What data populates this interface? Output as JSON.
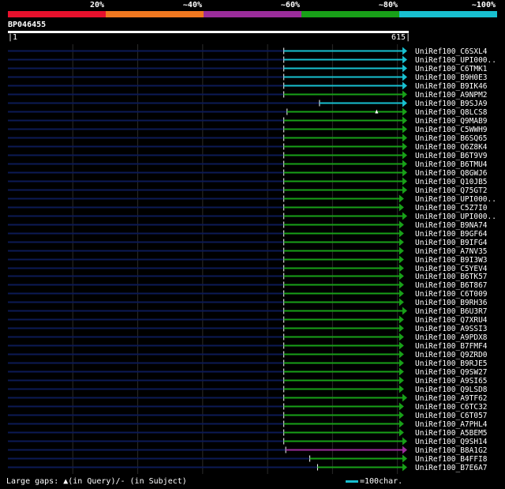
{
  "query": {
    "id": "BP046455",
    "start": "1",
    "end": "615",
    "length": 615
  },
  "legend": [
    {
      "label": "20%",
      "color": "#e8112d"
    },
    {
      "label": "~40%",
      "color": "#f07820"
    },
    {
      "label": "~60%",
      "color": "#9b2d9b"
    },
    {
      "label": "~80%",
      "color": "#18a018"
    },
    {
      "label": "~100%",
      "color": "#18c0d0"
    }
  ],
  "footer": {
    "gaps_text": "Large gaps: ▲(in Query)/- (in Subject)",
    "scale_text": "=100char."
  },
  "chart_data": {
    "type": "alignment",
    "query_length": 615,
    "hits": [
      {
        "name": "UniRef100_C6SXL4",
        "start": 425,
        "end": 615,
        "identity_band": "~100%"
      },
      {
        "name": "UniRef100_UPI000..",
        "start": 425,
        "end": 615,
        "identity_band": "~100%"
      },
      {
        "name": "UniRef100_C6TMK1",
        "start": 425,
        "end": 615,
        "identity_band": "~100%"
      },
      {
        "name": "UniRef100_B9H0E3",
        "start": 425,
        "end": 615,
        "identity_band": "~100%"
      },
      {
        "name": "UniRef100_B9IK46",
        "start": 425,
        "end": 615,
        "identity_band": "~100%"
      },
      {
        "name": "UniRef100_A9NPM2",
        "start": 425,
        "end": 615,
        "identity_band": "~80%"
      },
      {
        "name": "UniRef100_B9SJA9",
        "start": 480,
        "end": 615,
        "identity_band": "~100%"
      },
      {
        "name": "UniRef100_Q8LCS8",
        "start": 430,
        "end": 615,
        "identity_band": "~80%",
        "query_gap_at": 568
      },
      {
        "name": "UniRef100_Q9MAB9",
        "start": 425,
        "end": 615,
        "identity_band": "~80%"
      },
      {
        "name": "UniRef100_C5WWH9",
        "start": 425,
        "end": 615,
        "identity_band": "~80%"
      },
      {
        "name": "UniRef100_B6SQ65",
        "start": 425,
        "end": 615,
        "identity_band": "~80%"
      },
      {
        "name": "UniRef100_Q6Z8K4",
        "start": 425,
        "end": 615,
        "identity_band": "~80%"
      },
      {
        "name": "UniRef100_B6T9V9",
        "start": 425,
        "end": 615,
        "identity_band": "~80%"
      },
      {
        "name": "UniRef100_B6TMU4",
        "start": 425,
        "end": 615,
        "identity_band": "~80%"
      },
      {
        "name": "UniRef100_Q8GWJ6",
        "start": 425,
        "end": 615,
        "identity_band": "~80%"
      },
      {
        "name": "UniRef100_Q10JB5",
        "start": 425,
        "end": 615,
        "identity_band": "~80%"
      },
      {
        "name": "UniRef100_Q75GT2",
        "start": 425,
        "end": 615,
        "identity_band": "~80%"
      },
      {
        "name": "UniRef100_UPI000..",
        "start": 425,
        "end": 610,
        "identity_band": "~80%"
      },
      {
        "name": "UniRef100_C5Z7I0",
        "start": 425,
        "end": 610,
        "identity_band": "~80%"
      },
      {
        "name": "UniRef100_UPI000..",
        "start": 425,
        "end": 615,
        "identity_band": "~80%"
      },
      {
        "name": "UniRef100_B9NA74",
        "start": 425,
        "end": 610,
        "identity_band": "~80%"
      },
      {
        "name": "UniRef100_B9GF64",
        "start": 425,
        "end": 610,
        "identity_band": "~80%"
      },
      {
        "name": "UniRef100_B9IFG4",
        "start": 425,
        "end": 610,
        "identity_band": "~80%"
      },
      {
        "name": "UniRef100_A7NV35",
        "start": 425,
        "end": 610,
        "identity_band": "~80%"
      },
      {
        "name": "UniRef100_B9I3W3",
        "start": 425,
        "end": 610,
        "identity_band": "~80%"
      },
      {
        "name": "UniRef100_C5YEV4",
        "start": 425,
        "end": 610,
        "identity_band": "~80%"
      },
      {
        "name": "UniRef100_B6TK57",
        "start": 425,
        "end": 610,
        "identity_band": "~80%"
      },
      {
        "name": "UniRef100_B6T867",
        "start": 425,
        "end": 610,
        "identity_band": "~80%"
      },
      {
        "name": "UniRef100_C6T009",
        "start": 425,
        "end": 610,
        "identity_band": "~80%"
      },
      {
        "name": "UniRef100_B9RH36",
        "start": 425,
        "end": 610,
        "identity_band": "~80%"
      },
      {
        "name": "UniRef100_B6U3R7",
        "start": 425,
        "end": 615,
        "identity_band": "~80%"
      },
      {
        "name": "UniRef100_Q7XRU4",
        "start": 425,
        "end": 610,
        "identity_band": "~80%"
      },
      {
        "name": "UniRef100_A9SSI3",
        "start": 425,
        "end": 610,
        "identity_band": "~80%"
      },
      {
        "name": "UniRef100_A9PDX8",
        "start": 425,
        "end": 610,
        "identity_band": "~80%"
      },
      {
        "name": "UniRef100_B7FMF4",
        "start": 425,
        "end": 610,
        "identity_band": "~80%"
      },
      {
        "name": "UniRef100_Q9ZRD0",
        "start": 425,
        "end": 610,
        "identity_band": "~80%"
      },
      {
        "name": "UniRef100_B9RJE5",
        "start": 425,
        "end": 610,
        "identity_band": "~80%"
      },
      {
        "name": "UniRef100_Q9SW27",
        "start": 425,
        "end": 610,
        "identity_band": "~80%"
      },
      {
        "name": "UniRef100_A9SI65",
        "start": 425,
        "end": 610,
        "identity_band": "~80%"
      },
      {
        "name": "UniRef100_Q9LSD8",
        "start": 425,
        "end": 610,
        "identity_band": "~80%"
      },
      {
        "name": "UniRef100_A9TF62",
        "start": 425,
        "end": 615,
        "identity_band": "~80%"
      },
      {
        "name": "UniRef100_C6TC32",
        "start": 425,
        "end": 610,
        "identity_band": "~80%"
      },
      {
        "name": "UniRef100_C6T057",
        "start": 425,
        "end": 610,
        "identity_band": "~80%"
      },
      {
        "name": "UniRef100_A7PHL4",
        "start": 425,
        "end": 610,
        "identity_band": "~80%"
      },
      {
        "name": "UniRef100_A5BEM5",
        "start": 425,
        "end": 610,
        "identity_band": "~80%"
      },
      {
        "name": "UniRef100_Q9SH14",
        "start": 425,
        "end": 615,
        "identity_band": "~80%"
      },
      {
        "name": "UniRef100_B8A1G2",
        "start": 428,
        "end": 615,
        "identity_band": "~60%"
      },
      {
        "name": "UniRef100_B4FFI8",
        "start": 465,
        "end": 615,
        "identity_band": "~80%"
      },
      {
        "name": "UniRef100_B7E6A7",
        "start": 477,
        "end": 615,
        "identity_band": "~80%"
      }
    ]
  }
}
